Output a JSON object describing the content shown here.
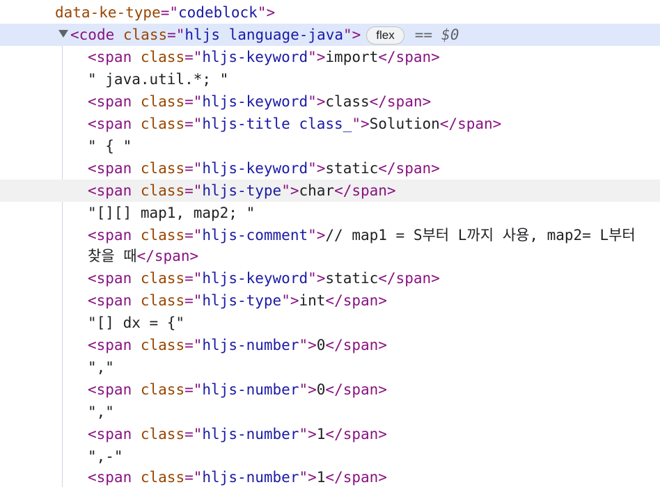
{
  "dom_lines": [
    {
      "kind": "attr-tail",
      "attr": "data-ke-type",
      "value": "codeblock"
    },
    {
      "kind": "code-open",
      "tag": "code",
      "attr": "class",
      "value": "hljs language-java",
      "badge": "flex",
      "equals": "==",
      "ref": "$0"
    },
    {
      "kind": "span",
      "class": "hljs-keyword",
      "text": "import"
    },
    {
      "kind": "text",
      "text": "\" java.util.*; \""
    },
    {
      "kind": "span",
      "class": "hljs-keyword",
      "text": "class"
    },
    {
      "kind": "span",
      "class": "hljs-title class_",
      "text": "Solution"
    },
    {
      "kind": "text",
      "text": "\" { \""
    },
    {
      "kind": "span",
      "class": "hljs-keyword",
      "text": "static"
    },
    {
      "kind": "span",
      "class": "hljs-type",
      "text": "char"
    },
    {
      "kind": "text",
      "text": "\"[][] map1, map2; \""
    },
    {
      "kind": "span",
      "class": "hljs-comment",
      "text": "// map1 = S부터 L까지 사용, map2= L부터"
    },
    {
      "kind": "span-cont",
      "text": "찾을 때"
    },
    {
      "kind": "span",
      "class": "hljs-keyword",
      "text": "static"
    },
    {
      "kind": "span",
      "class": "hljs-type",
      "text": "int"
    },
    {
      "kind": "text",
      "text": "\"[] dx = {\""
    },
    {
      "kind": "span",
      "class": "hljs-number",
      "text": "0"
    },
    {
      "kind": "text",
      "text": "\",\""
    },
    {
      "kind": "span",
      "class": "hljs-number",
      "text": "0"
    },
    {
      "kind": "text",
      "text": "\",\""
    },
    {
      "kind": "span",
      "class": "hljs-number",
      "text": "1"
    },
    {
      "kind": "text",
      "text": "\",-\""
    },
    {
      "kind": "span",
      "class": "hljs-number",
      "text": "1"
    }
  ],
  "tokens": {
    "span_open": "<span",
    "span_close": "</span>",
    "class_attr": "class",
    "eq_quote": "=\"",
    "close_quote_gt": "\">"
  }
}
